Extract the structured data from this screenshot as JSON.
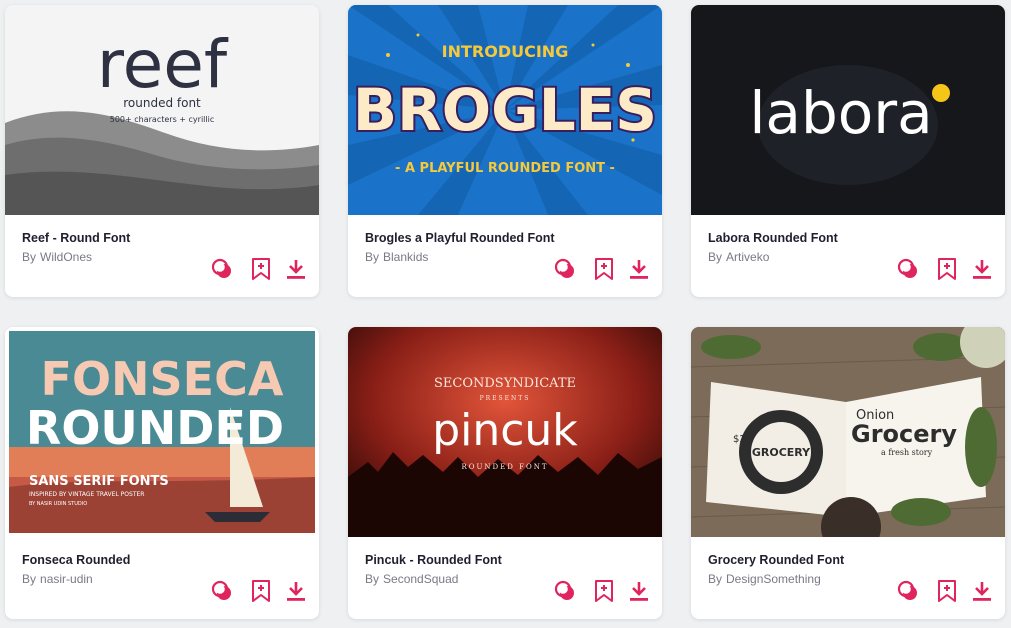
{
  "accent": "#e0245e",
  "author_prefix": "By",
  "icons": [
    "collection-icon",
    "bookmark-add-icon",
    "download-icon"
  ],
  "cards": [
    {
      "title": "Reef - Round Font",
      "author": "WildOnes",
      "thumb": {
        "heading": "reef",
        "line1": "rounded font",
        "line2": "500+ characters + cyrillic"
      }
    },
    {
      "title": "Brogles a Playful Rounded Font",
      "author": "Blankids",
      "thumb": {
        "heading": "BROGLES",
        "line1": "INTRODUCING",
        "line2": "- A PLAYFUL ROUNDED FONT -"
      }
    },
    {
      "title": "Labora Rounded Font",
      "author": "Artiveko",
      "thumb": {
        "heading": "labora"
      }
    },
    {
      "title": "Fonseca Rounded",
      "author": "nasir-udin",
      "thumb": {
        "heading": "FONSECA",
        "line1": "ROUNDED",
        "line2": "SANS SERIF FONTS",
        "line3": "INSPIRED BY VINTAGE TRAVEL POSTER",
        "line4": "BY NASIR UDIN STUDIO"
      }
    },
    {
      "title": "Pincuk - Rounded Font",
      "author": "SecondSquad",
      "thumb": {
        "heading": "pincuk",
        "line1": "SECONDSYNDICATE",
        "line2": "PRESENTS",
        "line3": "ROUNDED FONT"
      }
    },
    {
      "title": "Grocery Rounded Font",
      "author": "DesignSomething",
      "thumb": {
        "heading": "Grocery",
        "line1": "Onion",
        "line2": "a fresh story",
        "line3": "$20",
        "line4": "GROCERY"
      }
    }
  ]
}
